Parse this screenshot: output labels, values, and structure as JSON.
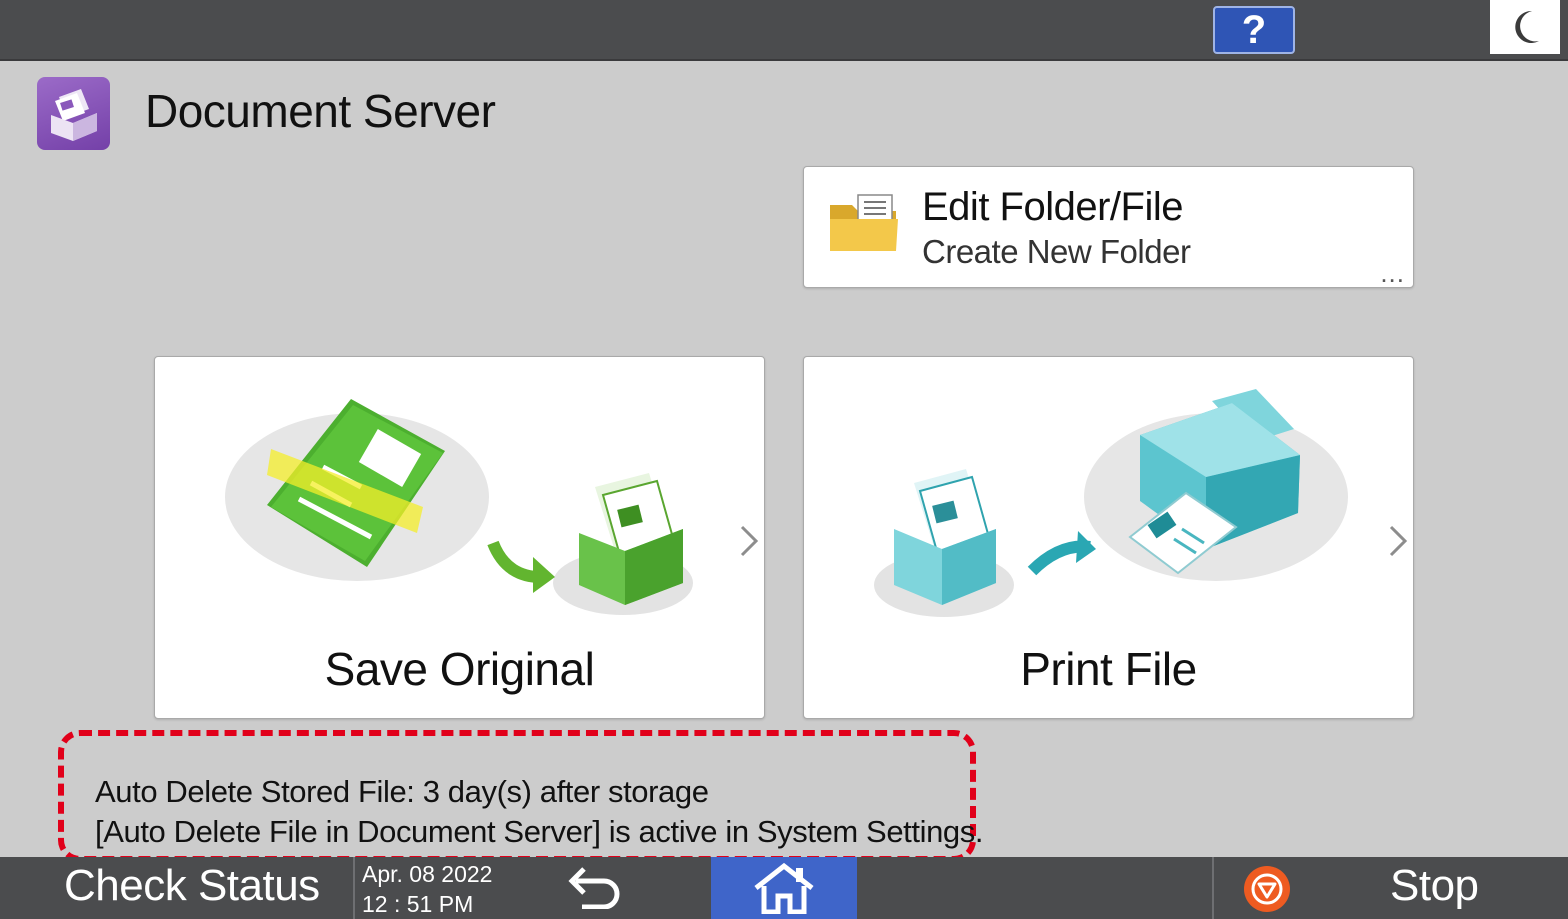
{
  "topbar": {
    "help_label": "?",
    "help_icon": "question-mark-icon",
    "sleep_icon": "moon-icon"
  },
  "header": {
    "title": "Document Server",
    "app_icon": "document-server-icon"
  },
  "cards": {
    "edit": {
      "title": "Edit Folder/File",
      "subtitle": "Create New Folder",
      "more": "...",
      "icon": "folder-icon"
    },
    "save": {
      "label": "Save Original",
      "icon": "scan-to-storage-illustration"
    },
    "print": {
      "label": "Print File",
      "icon": "storage-to-printer-illustration"
    }
  },
  "notice": {
    "line1": "Auto Delete Stored File: 3 day(s) after storage",
    "line2": "[Auto Delete File in Document Server] is active in System Settings."
  },
  "bottombar": {
    "check_status": "Check Status",
    "date": "Apr. 08 2022",
    "time": "12 : 51 PM",
    "back_icon": "back-arrow-icon",
    "home_icon": "home-icon",
    "stop_icon": "stop-icon",
    "stop_label": "Stop"
  },
  "colors": {
    "background": "#cccccc",
    "bar": "#4b4c4e",
    "accent_blue": "#3f65c9",
    "notice_border": "#e1001a",
    "stop_orange": "#ee5b21",
    "app_purple": "#7440a8"
  }
}
